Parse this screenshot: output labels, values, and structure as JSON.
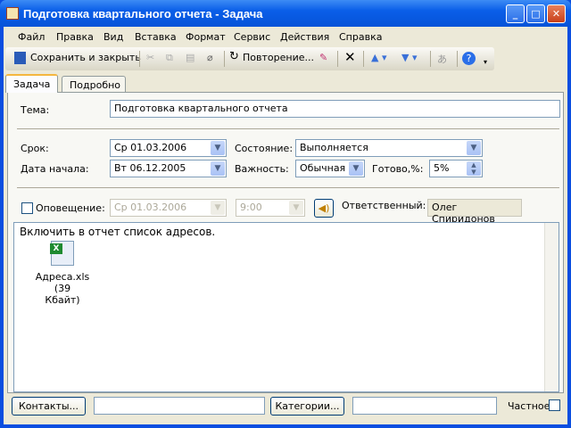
{
  "window": {
    "title": "Подготовка квартального отчета - Задача"
  },
  "menu": [
    "Файл",
    "Правка",
    "Вид",
    "Вставка",
    "Формат",
    "Сервис",
    "Действия",
    "Справка"
  ],
  "toolbar": {
    "save_close": "Сохранить и закрыть",
    "recurrence": "Повторение..."
  },
  "tabs": [
    "Задача",
    "Подробно"
  ],
  "form": {
    "subject_label": "Тема:",
    "subject": "Подготовка квартального отчета",
    "due_label": "Срок:",
    "due": "Ср 01.03.2006",
    "start_label": "Дата начала:",
    "start": "Вт 06.12.2005",
    "status_label": "Состояние:",
    "status": "Выполняется",
    "priority_label": "Важность:",
    "priority": "Обычная",
    "complete_label": "Готово,%:",
    "complete": "5%",
    "reminder_label": "Оповещение:",
    "reminder_date": "Ср 01.03.2006",
    "reminder_time": "9:00",
    "owner_label": "Ответственный:",
    "owner": "Олег Спиридонов"
  },
  "body": {
    "text": "Включить в отчет список адресов.",
    "attachment_line1": "Адреса.xls (39",
    "attachment_line2": "Кбайт)"
  },
  "footer": {
    "contacts": "Контакты...",
    "categories": "Категории...",
    "private_label": "Частное"
  }
}
